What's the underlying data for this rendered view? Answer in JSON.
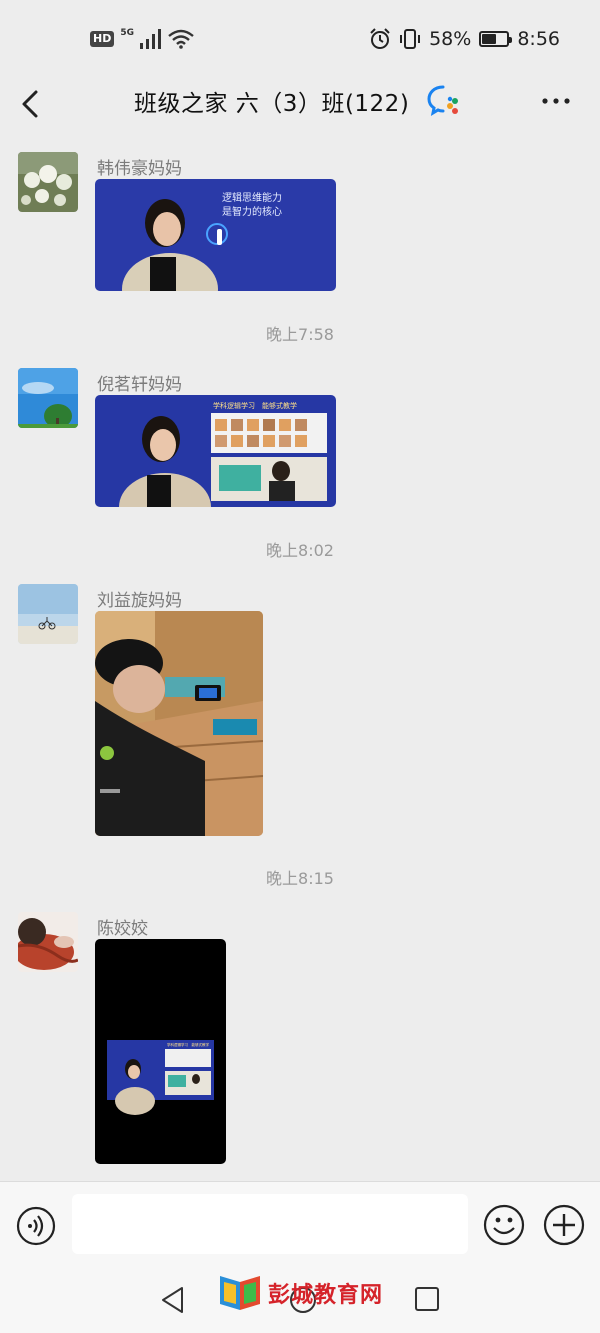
{
  "status_bar": {
    "hd": "HD",
    "network": "5G",
    "battery_percent": "58%",
    "battery_level": 0.58,
    "time": "8:56"
  },
  "header": {
    "title": "班级之家 六（3）班(122)",
    "icons": {
      "back": "chevron-left-icon",
      "work": "wecom-icon",
      "more": "more-dots-icon"
    }
  },
  "messages": [
    {
      "sender": "韩伟豪妈妈",
      "avatar": "white-roses-avatar",
      "media_type": "video",
      "media_text": [
        "逻辑思维能力",
        "是智力的核心"
      ]
    },
    {
      "timestamp": "晚上7:58"
    },
    {
      "sender": "倪茗轩妈妈",
      "avatar": "tree-sky-avatar",
      "media_type": "video",
      "media_text": [
        "学科逻辑学习　能够式教学"
      ]
    },
    {
      "timestamp": "晚上8:02"
    },
    {
      "sender": "刘益旋妈妈",
      "avatar": "cyclist-sky-avatar",
      "media_type": "photo"
    },
    {
      "timestamp": "晚上8:15"
    },
    {
      "sender": "陈姣姣",
      "avatar": "red-scarf-avatar",
      "media_type": "screenshot",
      "media_text": [
        "学科逻辑学习　能够式教学"
      ]
    }
  ],
  "input": {
    "placeholder": "",
    "value": ""
  },
  "colors": {
    "background": "#ededed",
    "bar": "#f7f7f7",
    "accent_blue": "#1a83f0",
    "watermark_red": "#d5232a"
  },
  "watermark": {
    "text": "彭城教育网"
  }
}
